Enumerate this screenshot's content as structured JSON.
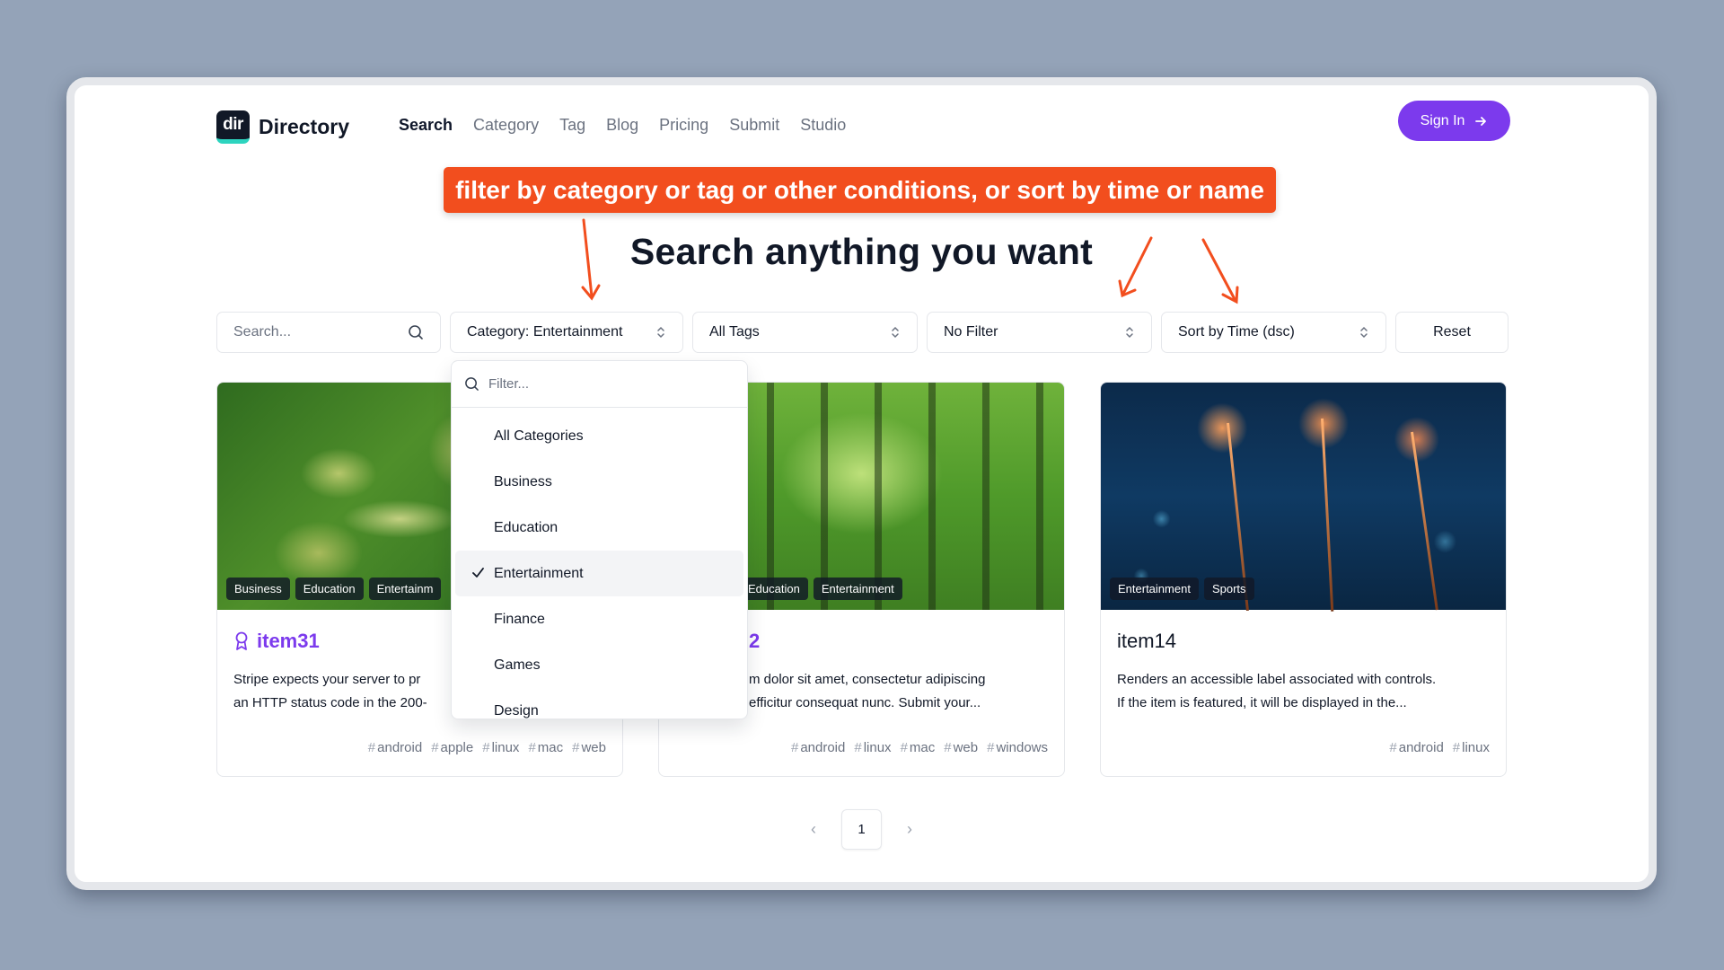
{
  "header": {
    "logo_mark": "dir",
    "logo_text": "Directory",
    "nav": [
      "Search",
      "Category",
      "Tag",
      "Blog",
      "Pricing",
      "Submit",
      "Studio"
    ],
    "sign_in": "Sign In"
  },
  "annotation": "filter by category or tag or other conditions, or sort by time or name",
  "headline": "Search anything you want",
  "filters": {
    "search_placeholder": "Search...",
    "category": "Category: Entertainment",
    "tags": "All Tags",
    "condition": "No Filter",
    "sort": "Sort by Time (dsc)",
    "reset": "Reset"
  },
  "dropdown": {
    "placeholder": "Filter...",
    "items": [
      "All Categories",
      "Business",
      "Education",
      "Entertainment",
      "Finance",
      "Games",
      "Design"
    ],
    "selected": "Entertainment"
  },
  "cards": [
    {
      "badges": [
        "Business",
        "Education",
        "Entertainm"
      ],
      "title": "item31",
      "featured": true,
      "desc_line1": "Stripe expects your server to pr",
      "desc_line2": "an HTTP status code in the 200-",
      "tags": [
        "android",
        "apple",
        "linux",
        "mac",
        "web"
      ]
    },
    {
      "badges": [
        "Education",
        "Entertainment"
      ],
      "title": "2",
      "featured": true,
      "desc_line1": "m dolor sit amet, consectetur adipiscing",
      "desc_line2": "efficitur consequat nunc. Submit your...",
      "tags": [
        "android",
        "linux",
        "mac",
        "web",
        "windows"
      ]
    },
    {
      "badges": [
        "Entertainment",
        "Sports"
      ],
      "title": "item14",
      "featured": false,
      "desc_line1": "Renders an accessible label associated with controls.",
      "desc_line2": "If the item is featured, it will be displayed in the...",
      "tags": [
        "android",
        "linux"
      ]
    }
  ],
  "pagination": {
    "current": "1"
  },
  "colors": {
    "accent": "#7c3aed",
    "annotation": "#f24e1e",
    "background": "#94a3b8"
  }
}
